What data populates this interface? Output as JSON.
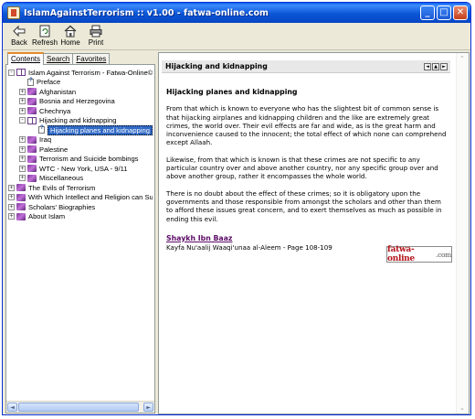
{
  "window": {
    "title": "IslamAgainstTerrorism :: v1.00 - fatwa-online.com",
    "controls": {
      "minimize": "_",
      "maximize": "□",
      "close": "✕"
    }
  },
  "toolbar": {
    "buttons": [
      {
        "label": "Back",
        "icon": "back-arrow-icon"
      },
      {
        "label": "Refresh",
        "icon": "refresh-icon"
      },
      {
        "label": "Home",
        "icon": "home-icon"
      },
      {
        "label": "Print",
        "icon": "printer-icon"
      }
    ]
  },
  "navigation": {
    "tabs": [
      "Contents",
      "Search",
      "Favorites"
    ],
    "active_tab": "Contents",
    "tree": [
      {
        "label": "Islam Against Terrorism - Fatwa-Online©",
        "level": 0,
        "kind": "book-open",
        "expander": "-"
      },
      {
        "label": "Preface",
        "level": 1,
        "kind": "page",
        "expander": ""
      },
      {
        "label": "Afghanistan",
        "level": 1,
        "kind": "book",
        "expander": "+"
      },
      {
        "label": "Bosnia and Herzegovina",
        "level": 1,
        "kind": "book",
        "expander": "+"
      },
      {
        "label": "Chechnya",
        "level": 1,
        "kind": "book",
        "expander": "+"
      },
      {
        "label": "Hijacking and kidnapping",
        "level": 1,
        "kind": "book-open",
        "expander": "-"
      },
      {
        "label": "Hijacking planes and kidnapping",
        "level": 2,
        "kind": "page",
        "expander": "",
        "selected": true
      },
      {
        "label": "Iraq",
        "level": 1,
        "kind": "book",
        "expander": "+"
      },
      {
        "label": "Palestine",
        "level": 1,
        "kind": "book",
        "expander": "+"
      },
      {
        "label": "Terrorism and Suicide bombings",
        "level": 1,
        "kind": "book",
        "expander": "+"
      },
      {
        "label": "WTC - New York, USA - 9/11",
        "level": 1,
        "kind": "book",
        "expander": "+"
      },
      {
        "label": "Miscellaneous",
        "level": 1,
        "kind": "book",
        "expander": "+"
      },
      {
        "label": "The Evils of Terrorism",
        "level": 0,
        "kind": "book",
        "expander": "+"
      },
      {
        "label": "With Which Intellect and Religion can Suic",
        "level": 0,
        "kind": "book",
        "expander": "+"
      },
      {
        "label": "Scholars' Biographies",
        "level": 0,
        "kind": "book",
        "expander": "+"
      },
      {
        "label": "About Islam",
        "level": 0,
        "kind": "book",
        "expander": "+"
      }
    ]
  },
  "topic": {
    "bar_title": "Hijacking and kidnapping",
    "heading": "Hijacking planes and kidnapping",
    "paragraphs": [
      "From that which is known to everyone who has the slightest bit of common sense is that hijacking airplanes and kidnapping children and the like are extremely great crimes, the world over. Their evil effects are far and wide, as is the great harm and inconvenience caused to the innocent; the total effect of which none can comprehend except Allaah.",
      "Likewise, from that which is known is that these crimes are not specific to any particular country over and above another country, nor any specific group over and above another group, rather it encompasses the whole world.",
      "There is no doubt about the effect of these crimes; so it is obligatory upon the governments and those responsible from amongst the scholars and other than them to afford these issues great concern, and to exert themselves as much as possible in ending this evil."
    ],
    "author": "Shaykh Ibn Baaz",
    "reference": "Kayfa Nu'aalij Waaqi'unaa al-Aleem - Page 108-109",
    "logo": {
      "brand": "fatwa-online",
      "suffix": ".com"
    },
    "nav_buttons": [
      "◄",
      "▲",
      "►"
    ]
  }
}
